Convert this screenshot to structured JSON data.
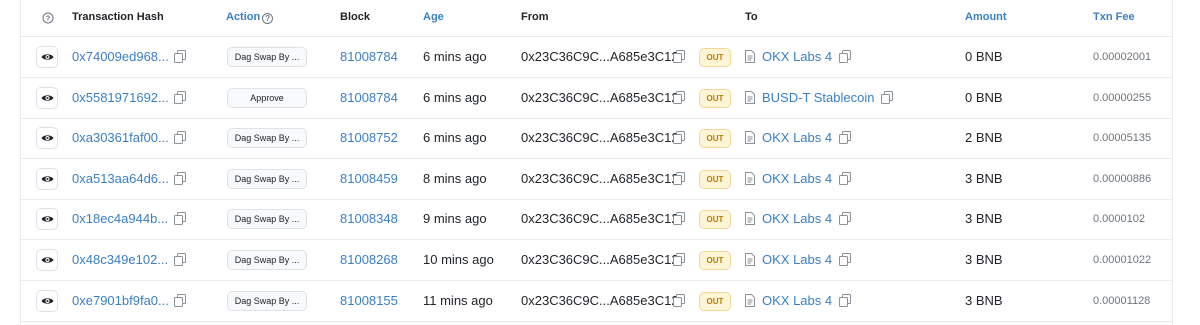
{
  "header": {
    "help_icon": "question-circle-icon",
    "transaction_hash": "Transaction Hash",
    "action": "Action",
    "block": "Block",
    "age": "Age",
    "from": "From",
    "to": "To",
    "amount": "Amount",
    "txn_fee": "Txn Fee"
  },
  "colors": {
    "link": "#3a7fc4",
    "out_badge_bg": "#fff4d6",
    "out_badge_text": "#b47d00"
  },
  "rows": [
    {
      "hash": "0x74009ed968...",
      "action": "Dag Swap By ...",
      "block": "81008784",
      "age": "6 mins ago",
      "from": "0x23C36C9C...A685e3C12",
      "direction": "OUT",
      "to": "OKX Labs 4",
      "amount": "0 BNB",
      "fee": "0.00002001"
    },
    {
      "hash": "0x5581971692...",
      "action": "Approve",
      "block": "81008784",
      "age": "6 mins ago",
      "from": "0x23C36C9C...A685e3C12",
      "direction": "OUT",
      "to": "BUSD-T Stablecoin",
      "amount": "0 BNB",
      "fee": "0.00000255"
    },
    {
      "hash": "0xa30361faf00...",
      "action": "Dag Swap By ...",
      "block": "81008752",
      "age": "6 mins ago",
      "from": "0x23C36C9C...A685e3C12",
      "direction": "OUT",
      "to": "OKX Labs 4",
      "amount": "2 BNB",
      "fee": "0.00005135"
    },
    {
      "hash": "0xa513aa64d6...",
      "action": "Dag Swap By ...",
      "block": "81008459",
      "age": "8 mins ago",
      "from": "0x23C36C9C...A685e3C12",
      "direction": "OUT",
      "to": "OKX Labs 4",
      "amount": "3 BNB",
      "fee": "0.00000886"
    },
    {
      "hash": "0x18ec4a944b...",
      "action": "Dag Swap By ...",
      "block": "81008348",
      "age": "9 mins ago",
      "from": "0x23C36C9C...A685e3C12",
      "direction": "OUT",
      "to": "OKX Labs 4",
      "amount": "3 BNB",
      "fee": "0.0000102"
    },
    {
      "hash": "0x48c349e102...",
      "action": "Dag Swap By ...",
      "block": "81008268",
      "age": "10 mins ago",
      "from": "0x23C36C9C...A685e3C12",
      "direction": "OUT",
      "to": "OKX Labs 4",
      "amount": "3 BNB",
      "fee": "0.00001022"
    },
    {
      "hash": "0xe7901bf9fa0...",
      "action": "Dag Swap By ...",
      "block": "81008155",
      "age": "11 mins ago",
      "from": "0x23C36C9C...A685e3C12",
      "direction": "OUT",
      "to": "OKX Labs 4",
      "amount": "3 BNB",
      "fee": "0.00001128"
    }
  ]
}
